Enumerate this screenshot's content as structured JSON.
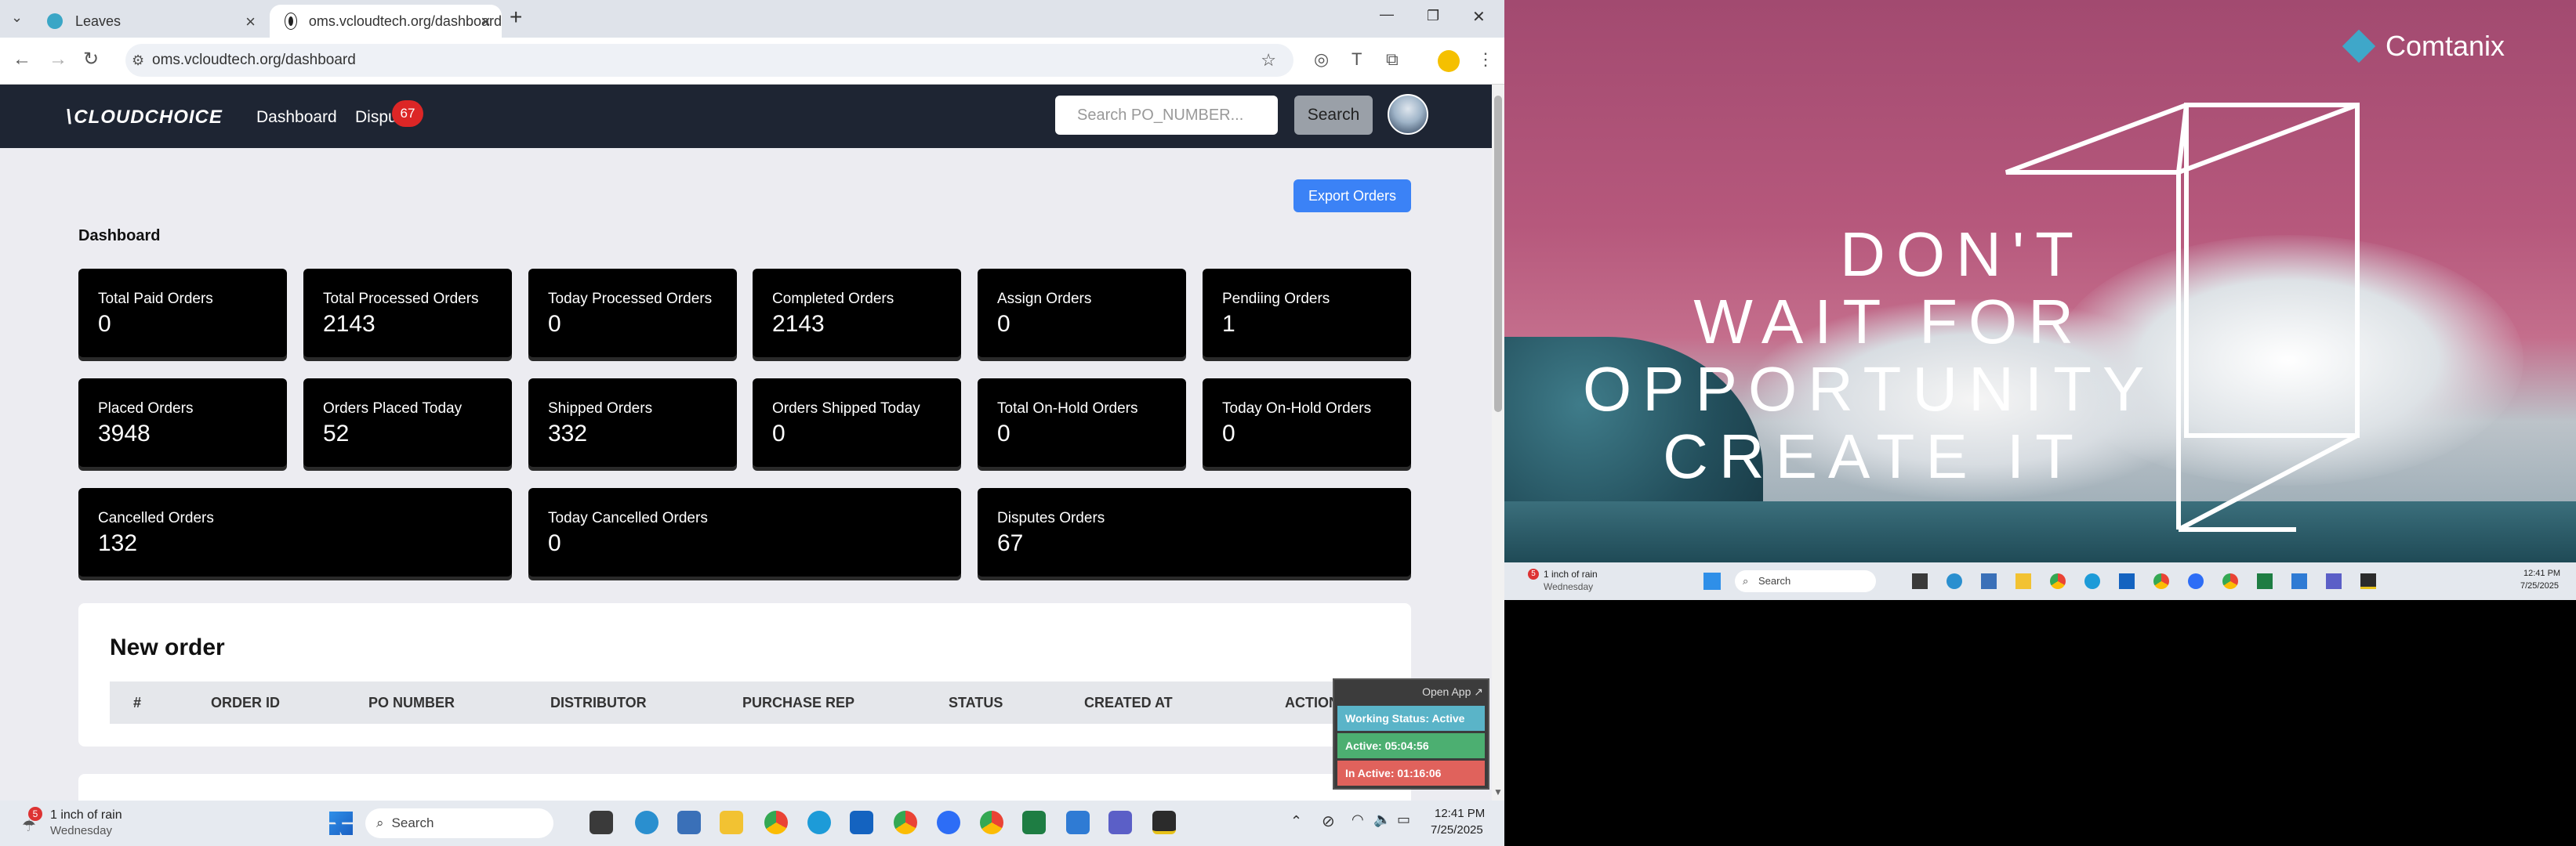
{
  "browser": {
    "tabs": [
      {
        "title": "Leaves",
        "active": false
      },
      {
        "title": "oms.vcloudtech.org/dashboard",
        "active": true
      }
    ],
    "new_tab": "+",
    "address": "oms.vcloudtech.org/dashboard",
    "window_controls": {
      "minimize": "—",
      "restore": "❐",
      "close": "✕"
    }
  },
  "app": {
    "logo": "CLOUDCHOICE",
    "nav": {
      "dashboard": "Dashboard",
      "disputes": "Dispu",
      "disputes_badge": "67"
    },
    "search": {
      "placeholder": "Search PO_NUMBER...",
      "button": "Search"
    },
    "export_button": "Export Orders",
    "section_title": "Dashboard",
    "stats_row1": [
      {
        "label": "Total Paid Orders",
        "value": "0"
      },
      {
        "label": "Total Processed Orders",
        "value": "2143"
      },
      {
        "label": "Today Processed Orders",
        "value": "0"
      },
      {
        "label": "Completed Orders",
        "value": "2143"
      },
      {
        "label": "Assign Orders",
        "value": "0"
      },
      {
        "label": "Pendiing Orders",
        "value": "1"
      }
    ],
    "stats_row2": [
      {
        "label": "Placed Orders",
        "value": "3948"
      },
      {
        "label": "Orders Placed Today",
        "value": "52"
      },
      {
        "label": "Shipped Orders",
        "value": "332"
      },
      {
        "label": "Orders Shipped Today",
        "value": "0"
      },
      {
        "label": "Total On-Hold Orders",
        "value": "0"
      },
      {
        "label": "Today On-Hold Orders",
        "value": "0"
      }
    ],
    "stats_row3": [
      {
        "label": "Cancelled Orders",
        "value": "132"
      },
      {
        "label": "Today Cancelled Orders",
        "value": "0"
      },
      {
        "label": "Disputes Orders",
        "value": "67"
      }
    ],
    "new_order": {
      "title": "New order",
      "columns": [
        "#",
        "ORDER ID",
        "PO NUMBER",
        "DISTRIBUTOR",
        "PURCHASE REP",
        "STATUS",
        "CREATED AT",
        "ACTION"
      ]
    }
  },
  "tracker_widget": {
    "open_app": "Open App ↗",
    "working_status": "Working Status: Active",
    "active": "Active: 05:04:56",
    "inactive": "In Active: 01:16:06"
  },
  "taskbar": {
    "weather_badge": "5",
    "weather": "1 inch of rain",
    "weather_sub": "Wednesday",
    "search": "Search",
    "time": "12:41 PM",
    "date": "7/25/2025"
  },
  "remote_screen": {
    "brand": "Comtanix",
    "quote": [
      "DON'T",
      "WAIT FOR",
      "OPPORTUNITY",
      "CREATE IT"
    ],
    "taskbar": {
      "weather_badge": "5",
      "weather": "1 inch of rain",
      "weather_sub": "Wednesday",
      "search": "Search",
      "time": "12:41 PM",
      "date": "7/25/2025"
    }
  },
  "colors": {
    "nav_bg": "#1e2533",
    "card_bg": "#000000",
    "accent_blue": "#3b82f6",
    "badge_red": "#dc2626",
    "widget_teal": "#5ab4c8",
    "widget_green": "#4caf71",
    "widget_red": "#e0625c"
  }
}
